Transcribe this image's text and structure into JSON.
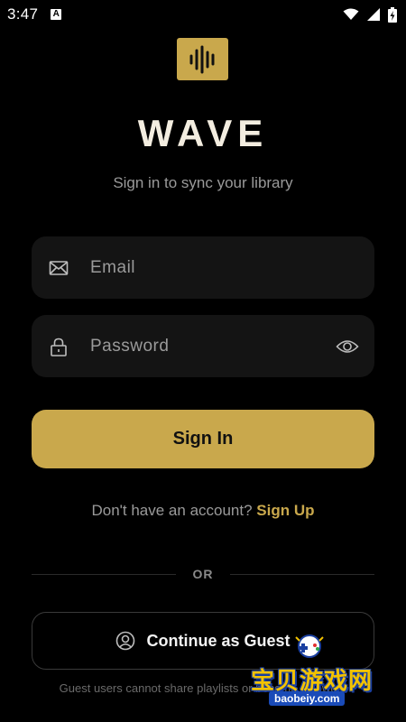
{
  "status_bar": {
    "time": "3:47",
    "notification_badge": "A",
    "icons": [
      "wifi-icon",
      "signal-icon",
      "battery-charging-icon"
    ]
  },
  "app": {
    "logo_icon": "sound-wave-icon",
    "title": "WAVE",
    "subtitle": "Sign in to sync your library"
  },
  "form": {
    "email_placeholder": "Email",
    "email_value": "",
    "password_placeholder": "Password",
    "password_value": "",
    "sign_in_label": "Sign In",
    "no_account_text": "Don't have an account?",
    "sign_up_label": "Sign Up"
  },
  "divider": {
    "label": "OR"
  },
  "guest": {
    "label": "Continue as Guest",
    "note": "Guest users cannot share playlists or become followers"
  },
  "watermark": {
    "text": "宝贝游戏网",
    "domain": "baobeiy.com"
  },
  "colors": {
    "background": "#000000",
    "accent": "#c9a84c",
    "field_bg": "#141414",
    "muted_text": "#9a9a9a",
    "title": "#f3ede0"
  }
}
